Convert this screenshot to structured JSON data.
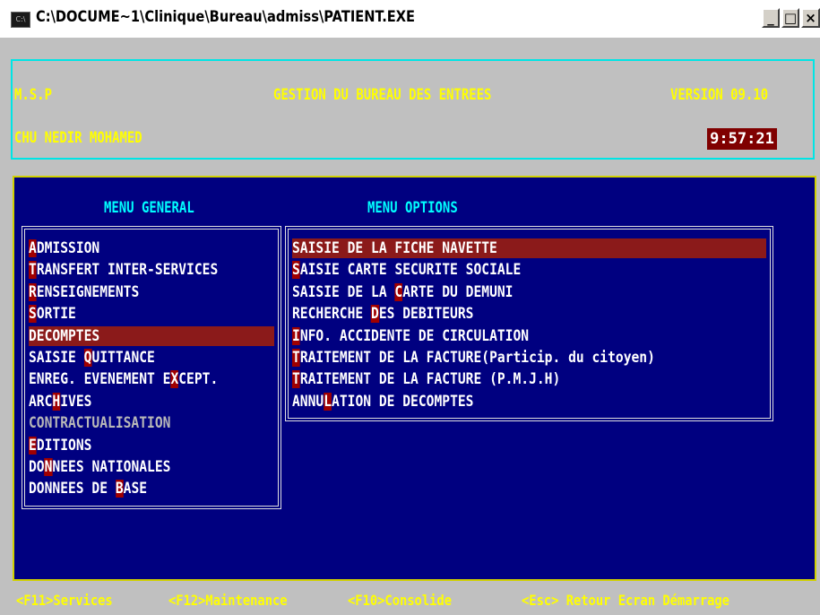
{
  "window": {
    "icon": "C:\\",
    "title": "C:\\DOCUME~1\\Clinique\\Bureau\\admiss\\PATIENT.EXE",
    "buttons": {
      "minimize": "_",
      "maximize": "□",
      "close": "×"
    }
  },
  "header": {
    "left": "M.S.P",
    "center": "GESTION DU BUREAU DES ENTREES",
    "version": "VERSION  09.10",
    "hospital": "CHU NEDIR MOHAMED",
    "time": "9:57:21"
  },
  "menu_general": {
    "title": "MENU GENERAL",
    "items": [
      {
        "label": "ADMISSION",
        "hot": 0
      },
      {
        "label": "TRANSFERT INTER-SERVICES",
        "hot": 0
      },
      {
        "label": "RENSEIGNEMENTS",
        "hot": 0
      },
      {
        "label": "SORTIE",
        "hot": 0
      },
      {
        "label": "DECOMPTES",
        "hot": 0,
        "selected": true
      },
      {
        "label": "SAISIE QUITTANCE",
        "hot": 7
      },
      {
        "label": "ENREG. EVENEMENT EXCEPT.",
        "hot": 18
      },
      {
        "label": "ARCHIVES",
        "hot": 3
      },
      {
        "label": "CONTRACTUALISATION",
        "hot": -1,
        "disabled": true
      },
      {
        "label": "EDITIONS",
        "hot": 0
      },
      {
        "label": "DONNEES NATIONALES",
        "hot": 2
      },
      {
        "label": "DONNEES DE BASE",
        "hot": 11
      }
    ]
  },
  "menu_options": {
    "title": "MENU OPTIONS",
    "items": [
      {
        "label": "SAISIE DE LA FICHE NAVETTE",
        "hot": 0,
        "selected": true
      },
      {
        "label": "SAISIE CARTE SECURITE SOCIALE",
        "hot": 0
      },
      {
        "label": "SAISIE DE LA CARTE DU DEMUNI",
        "hot": 13
      },
      {
        "label": "RECHERCHE DES DEBITEURS",
        "hot": 10
      },
      {
        "label": "INFO. ACCIDENTE DE CIRCULATION",
        "hot": 0
      },
      {
        "label": "TRAITEMENT DE LA FACTURE(Particip. du citoyen)",
        "hot": 0
      },
      {
        "label": "TRAITEMENT DE LA FACTURE (P.M.J.H)",
        "hot": 0
      },
      {
        "label": "ANNULATION DE DECOMPTES",
        "hot": 4
      }
    ]
  },
  "footer": {
    "services": "<F11>Services",
    "maintenance": "<F12>Maintenance",
    "consolide": "<F10>Consolide",
    "retour": "<Esc> Retour Ecran Démarrage"
  },
  "colors": {
    "console_bg": "#c0c0c0",
    "panel_bg": "#000080",
    "highlight": "#8b1a1a",
    "text_yellow": "#ffff00",
    "text_cyan": "#00ffff",
    "clock_bg": "#800000"
  }
}
